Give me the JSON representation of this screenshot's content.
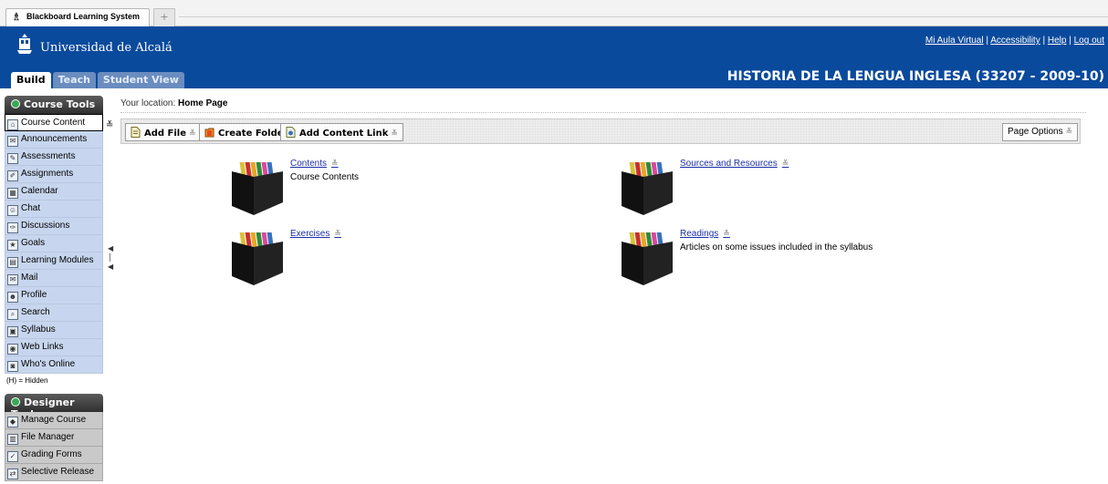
{
  "browser": {
    "tab_title": "Blackboard Learning System",
    "new_tab_label": "+"
  },
  "header": {
    "university": "Universidad de Alcalá",
    "links": [
      "Mi Aula Virtual",
      "Accessibility",
      "Help",
      "Log out"
    ],
    "link_separator": "|",
    "course_title": "HISTORIA DE LA LENGUA INGLESA (33207 - 2009-10)",
    "modes": [
      "Build",
      "Teach",
      "Student View"
    ],
    "active_mode": "Build",
    "brand_color": "#0a4a9c"
  },
  "sidebar": {
    "course_tools_title": "Course Tools",
    "course_tools": [
      {
        "label": "Course Content",
        "icon": "home-icon"
      },
      {
        "label": "Announcements",
        "icon": "megaphone-icon"
      },
      {
        "label": "Assessments",
        "icon": "assessment-icon"
      },
      {
        "label": "Assignments",
        "icon": "assignment-icon"
      },
      {
        "label": "Calendar",
        "icon": "calendar-icon"
      },
      {
        "label": "Chat",
        "icon": "chat-icon"
      },
      {
        "label": "Discussions",
        "icon": "pin-icon"
      },
      {
        "label": "Goals",
        "icon": "goals-icon"
      },
      {
        "label": "Learning Modules",
        "icon": "module-icon"
      },
      {
        "label": "Mail",
        "icon": "mail-icon"
      },
      {
        "label": "Profile",
        "icon": "profile-icon"
      },
      {
        "label": "Search",
        "icon": "search-icon"
      },
      {
        "label": "Syllabus",
        "icon": "syllabus-icon"
      },
      {
        "label": "Web Links",
        "icon": "web-links-icon"
      },
      {
        "label": "Who's Online",
        "icon": "online-users-icon"
      }
    ],
    "hidden_note": "(H) = Hidden",
    "designer_tools_title": "Designer Tools",
    "designer_tools": [
      {
        "label": "Manage Course",
        "icon": "manage-course-icon"
      },
      {
        "label": "File Manager",
        "icon": "file-manager-icon"
      },
      {
        "label": "Grading Forms",
        "icon": "grading-forms-icon"
      },
      {
        "label": "Selective Release",
        "icon": "selective-release-icon"
      }
    ],
    "expander_glyph": "≚"
  },
  "main": {
    "location_prefix": "Your location:",
    "location": "Home Page",
    "actions": {
      "add_file": "Add File",
      "create_folder": "Create Folder",
      "add_content_link": "Add Content Link",
      "page_options": "Page Options"
    },
    "chevron_glyph": "≚",
    "items": [
      {
        "title": "Contents",
        "description": "Course Contents"
      },
      {
        "title": "Sources and Resources",
        "description": ""
      },
      {
        "title": "Exercises",
        "description": ""
      },
      {
        "title": "Readings",
        "description": "Articles on some issues included in the syllabus"
      }
    ]
  }
}
